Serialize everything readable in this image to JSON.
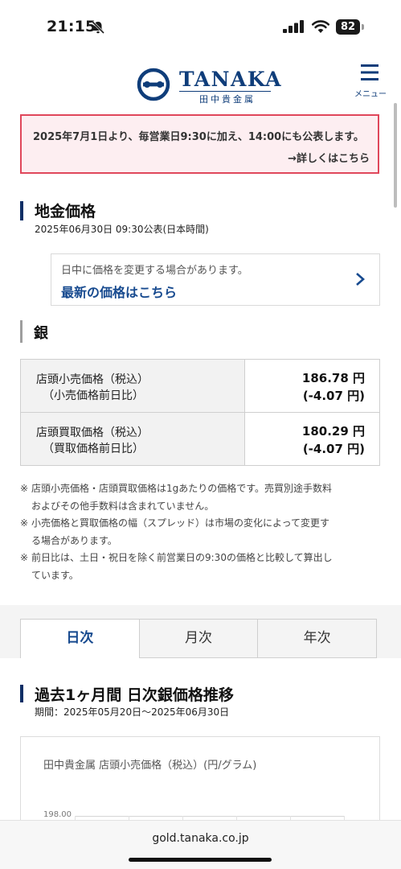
{
  "status_bar": {
    "time": "21:15",
    "battery": "82"
  },
  "header": {
    "brand": "TANAKA",
    "brand_sub": "田中貴金属",
    "menu_label": "メニュー"
  },
  "notice": {
    "text": "2025年7月1日より、毎営業日9:30に加え、14:00にも公表します。",
    "link": "→詳しくはこちら"
  },
  "price_section": {
    "title": "地金価格",
    "published": "2025年06月30日 09:30公表(日本時間)"
  },
  "info_box": {
    "note": "日中に価格を変更する場合があります。",
    "link": "最新の価格はこちら"
  },
  "metal": {
    "title": "銀"
  },
  "price_table": [
    {
      "label": "店頭小売価格（税込）",
      "sublabel": "（小売価格前日比）",
      "value": "186.78 円",
      "change": "(-4.07 円)"
    },
    {
      "label": "店頭買取価格（税込）",
      "sublabel": "（買取価格前日比）",
      "value": "180.29 円",
      "change": "(-4.07 円)"
    }
  ],
  "notes": [
    {
      "line1": "店頭小売価格・店頭買取価格は1gあたりの価格です。売買別途手数料",
      "line2": "およびその他手数料は含まれていません。"
    },
    {
      "line1": "小売価格と買取価格の幅（スプレッド）は市場の変化によって変更す",
      "line2": "る場合があります。"
    },
    {
      "line1": "前日比は、土日・祝日を除く前営業日の9:30の価格と比較して算出し",
      "line2": "ています。"
    }
  ],
  "note_mark": "※",
  "tabs": [
    {
      "label": "日次",
      "active": true
    },
    {
      "label": "月次",
      "active": false
    },
    {
      "label": "年次",
      "active": false
    }
  ],
  "trend_section": {
    "title": "過去1ヶ月間 日次銀価格推移",
    "period": "期間：2025年05月20日～2025年06月30日"
  },
  "chart": {
    "title": "田中貴金属 店頭小売価格（税込）(円/グラム)",
    "ytick_top": "198.00"
  },
  "browser": {
    "url": "gold.tanaka.co.jp"
  },
  "colors": {
    "brand": "#0f3d7a",
    "notice_border": "#e0475b",
    "notice_bg": "#fdeef1",
    "link": "#174a8f"
  }
}
